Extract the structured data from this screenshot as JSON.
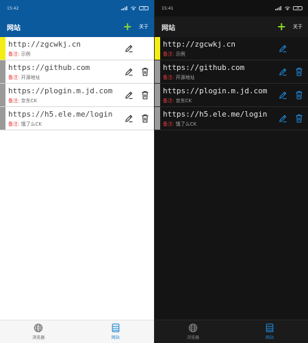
{
  "light": {
    "status": {
      "time": "15:42",
      "battery": "38"
    },
    "appbar": {
      "title": "网站",
      "add_symbol": "+",
      "about_label": "关于"
    },
    "accent_colors": {
      "appbar": "#0b5a9e",
      "plus": "#8ddc2a",
      "note_label": "#e23b3b",
      "highlight_bar": "#f2ee15"
    },
    "sites": [
      {
        "url": "http://zgcwkj.cn",
        "note_label": "备注:",
        "note": "示例",
        "deletable": false,
        "highlight": true
      },
      {
        "url": "https://github.com",
        "note_label": "备注:",
        "note": "开源地址",
        "deletable": true,
        "highlight": false
      },
      {
        "url": "https://plogin.m.jd.com",
        "note_label": "备注:",
        "note": "京东CK",
        "deletable": true,
        "highlight": false
      },
      {
        "url": "https://h5.ele.me/login",
        "note_label": "备注:",
        "note": "饿了么CK",
        "deletable": true,
        "highlight": false
      }
    ],
    "nav": [
      {
        "label": "浏览器",
        "icon": "globe-icon",
        "active": false
      },
      {
        "label": "网站",
        "icon": "list-icon",
        "active": true
      }
    ]
  },
  "dark": {
    "status": {
      "time": "15:41",
      "battery": "38"
    },
    "appbar": {
      "title": "网站",
      "add_symbol": "+",
      "about_label": "关于"
    },
    "accent_colors": {
      "icons": "#1f86d6",
      "plus": "#8ddc2a",
      "note_label": "#e23b3b",
      "highlight_bar": "#f2ee15"
    },
    "sites": [
      {
        "url": "http://zgcwkj.cn",
        "note_label": "备注:",
        "note": "示例",
        "deletable": false,
        "highlight": true
      },
      {
        "url": "https://github.com",
        "note_label": "备注:",
        "note": "开源地址",
        "deletable": true,
        "highlight": false
      },
      {
        "url": "https://plogin.m.jd.com",
        "note_label": "备注:",
        "note": "京东CK",
        "deletable": true,
        "highlight": false
      },
      {
        "url": "https://h5.ele.me/login",
        "note_label": "备注:",
        "note": "饿了么CK",
        "deletable": true,
        "highlight": false
      }
    ],
    "nav": [
      {
        "label": "浏览器",
        "icon": "globe-icon",
        "active": false
      },
      {
        "label": "网站",
        "icon": "list-icon",
        "active": true
      }
    ]
  }
}
